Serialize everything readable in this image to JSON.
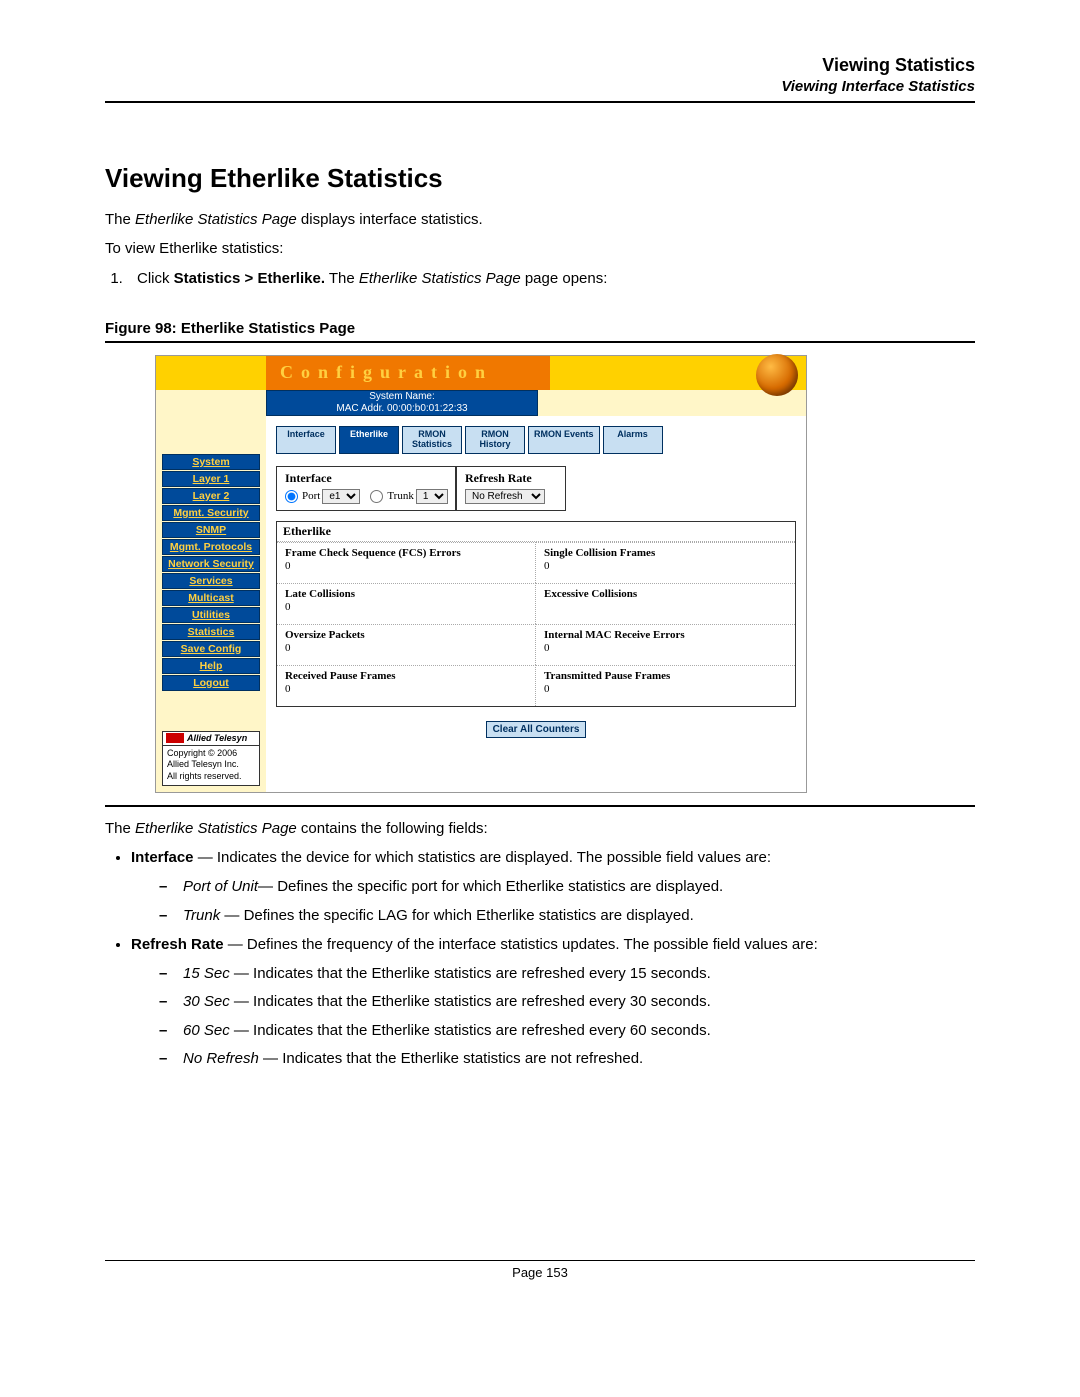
{
  "header": {
    "title": "Viewing Statistics",
    "subtitle": "Viewing Interface Statistics"
  },
  "h1": "Viewing Etherlike Statistics",
  "intro": {
    "p1_pre": "The ",
    "p1_ital": "Etherlike Statistics Page",
    "p1_post": " displays interface statistics.",
    "p2": "To view Etherlike statistics:",
    "step_pre": "Click ",
    "step_bold": "Statistics > Etherlike.",
    "step_mid": " The ",
    "step_ital": "Etherlike Statistics Page",
    "step_post": " page opens:"
  },
  "figure": {
    "caption": "Figure 98:  Etherlike Statistics Page"
  },
  "shot": {
    "config_title": "Configuration",
    "sysname": "System Name:",
    "mac": "MAC Addr. 00:00:b0:01:22:33",
    "tabs": {
      "interface": "Interface",
      "etherlike": "Etherlike",
      "rmon_stats_l1": "RMON",
      "rmon_stats_l2": "Statistics",
      "rmon_hist_l1": "RMON",
      "rmon_hist_l2": "History",
      "rmon_events": "RMON Events",
      "alarms": "Alarms"
    },
    "sidebar": [
      "System",
      "Layer 1",
      "Layer 2",
      "Mgmt. Security",
      "SNMP",
      "Mgmt. Protocols",
      "Network Security",
      "Services",
      "Multicast",
      "Utilities",
      "Statistics",
      "Save Config",
      "Help",
      "Logout"
    ],
    "copyright": {
      "brand": "Allied Telesyn",
      "line1": "Copyright © 2006",
      "line2": "Allied Telesyn Inc.",
      "line3": "All rights reserved."
    },
    "panel": {
      "interface_label": "Interface",
      "port_label": "Port",
      "port_val": "e1",
      "trunk_label": "Trunk",
      "trunk_val": "1",
      "refresh_label": "Refresh Rate",
      "refresh_val": "No Refresh"
    },
    "eth_section_title": "Etherlike",
    "eth_stats": [
      {
        "name": "Frame Check Sequence (FCS) Errors",
        "value": "0"
      },
      {
        "name": "Single Collision Frames",
        "value": "0"
      },
      {
        "name": "Late Collisions",
        "value": "0"
      },
      {
        "name": "Excessive Collisions",
        "value": ""
      },
      {
        "name": "Oversize Packets",
        "value": "0"
      },
      {
        "name": "Internal MAC Receive Errors",
        "value": "0"
      },
      {
        "name": "Received Pause Frames",
        "value": "0"
      },
      {
        "name": "Transmitted Pause Frames",
        "value": "0"
      }
    ],
    "clear_btn": "Clear All Counters"
  },
  "after": {
    "p_pre": "The ",
    "p_ital": "Etherlike Statistics Page",
    "p_post": " contains the following fields:",
    "b1_label": "Interface",
    "b1_rest": " — Indicates the device for which statistics are displayed. The possible field values are:",
    "b1_d1_ital": "Port of Unit",
    "b1_d1_rest": "— Defines the specific port for which Etherlike statistics are displayed.",
    "b1_d2_ital": "Trunk",
    "b1_d2_rest": " — Defines the specific LAG for which Etherlike statistics are displayed.",
    "b2_label": "Refresh Rate",
    "b2_rest": " — Defines the frequency of the interface statistics updates. The possible field values are:",
    "b2_d1_ital": "15 Sec",
    "b2_d1_rest": " — Indicates that the Etherlike statistics are refreshed every 15 seconds.",
    "b2_d2_ital": "30 Sec",
    "b2_d2_rest": " — Indicates that the Etherlike statistics are refreshed every 30 seconds.",
    "b2_d3_ital": "60 Sec",
    "b2_d3_rest": " — Indicates that the Etherlike statistics are refreshed every 60 seconds.",
    "b2_d4_ital": "No Refresh",
    "b2_d4_rest": " — Indicates that the Etherlike statistics are not refreshed."
  },
  "footer": "Page 153"
}
